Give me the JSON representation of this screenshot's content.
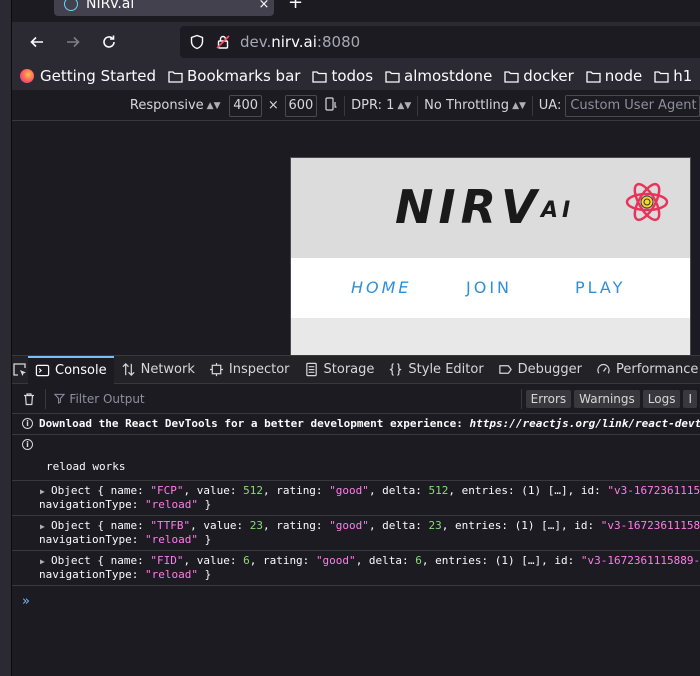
{
  "browser": {
    "tab_title": "NIRV.ai",
    "tab_close": "×",
    "new_tab": "+",
    "url_prefix": "dev.",
    "url_host": "nirv.ai",
    "url_port": ":8080"
  },
  "bookmarks": [
    "Getting Started",
    "Bookmarks bar",
    "todos",
    "almostdone",
    "docker",
    "node",
    "h1"
  ],
  "rdm": {
    "device": "Responsive",
    "width": "400",
    "times": "×",
    "height": "600",
    "dpr": "DPR: 1",
    "throttling": "No Throttling",
    "ua_label": "UA:",
    "ua_placeholder": "Custom User Agent"
  },
  "site": {
    "logo_main": "NIRV",
    "logo_sub": "AI",
    "nav": [
      "HOME",
      "JOIN",
      "PLAY"
    ]
  },
  "devtools": {
    "tabs": [
      "Console",
      "Network",
      "Inspector",
      "Storage",
      "Style Editor",
      "Debugger",
      "Performance"
    ],
    "filter_placeholder": "Filter Output",
    "filter_buttons": [
      "Errors",
      "Warnings",
      "Logs",
      "I"
    ]
  },
  "console": {
    "devtools_msg": "Download the React DevTools for a better development experience: ",
    "devtools_link": "https://reactjs.org/link/react-devtools",
    "reload_msg": "reload works",
    "objects": [
      {
        "name": "\"FCP\"",
        "value": "512",
        "rating": "\"good\"",
        "delta": "512",
        "id": "\"v3-1672361115"
      },
      {
        "name": "\"TTFB\"",
        "value": "23",
        "rating": "\"good\"",
        "delta": "23",
        "id": "\"v3-16723611158"
      },
      {
        "name": "\"FID\"",
        "value": "6",
        "rating": "\"good\"",
        "delta": "6",
        "id": "\"v3-1672361115889-"
      }
    ],
    "nav_type_label": "navigationType:",
    "nav_type_value": "\"reload\"",
    "entries": "entries: (1) […], id: "
  },
  "colors": {
    "accent": "#75bfff",
    "string": "#ff7de9",
    "number": "#86de74",
    "site_nav": "#2f8fd8"
  }
}
